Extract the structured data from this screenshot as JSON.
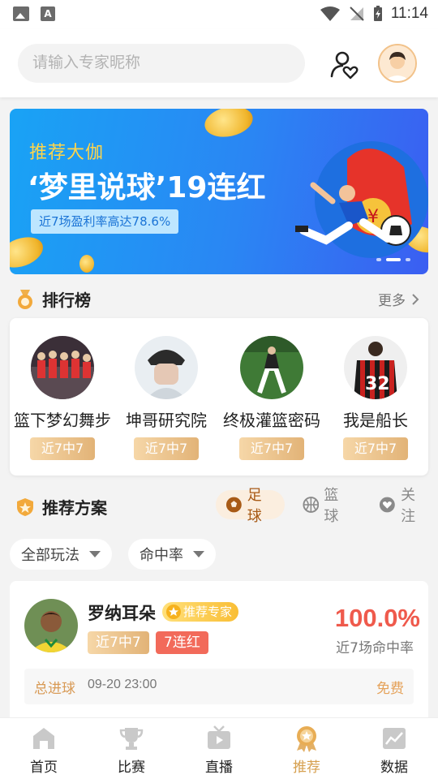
{
  "status_bar": {
    "time": "11:14",
    "left_icons": [
      "image-icon",
      "a-icon"
    ],
    "right_icons": [
      "wifi-icon",
      "no-signal-icon",
      "battery-charging-icon"
    ]
  },
  "header": {
    "search_placeholder": "请输入专家昵称",
    "icons": [
      "user-heart-icon",
      "avatar"
    ]
  },
  "banner": {
    "tag": "推荐大伽",
    "title": "‘梦里说球’19连红",
    "subtitle": "近7场盈利率高达78.6%",
    "active_slide": 1,
    "slide_count": 2
  },
  "ranking": {
    "title": "排行榜",
    "more_label": "更多",
    "items": [
      {
        "name": "篮下梦幻舞步",
        "badge": "近7中7"
      },
      {
        "name": "坤哥研究院",
        "badge": "近7中7"
      },
      {
        "name": "终极灌篮密码",
        "badge": "近7中7"
      },
      {
        "name": "我是船长",
        "badge": "近7中7"
      }
    ]
  },
  "plans": {
    "title": "推荐方案",
    "tabs": [
      {
        "label": "足球",
        "active": true
      },
      {
        "label": "篮球",
        "active": false
      },
      {
        "label": "关注",
        "active": false
      }
    ],
    "filters": [
      "全部玩法",
      "命中率"
    ],
    "card": {
      "name": "罗纳耳朵",
      "expert_tag": "推荐专家",
      "pills": [
        "近7中7",
        "7连红"
      ],
      "rate": "100.0%",
      "rate_label": "近7场命中率",
      "match": {
        "type": "总进球",
        "time": "09-20 23:00",
        "price": "免费"
      }
    }
  },
  "tabbar": {
    "items": [
      {
        "label": "首页",
        "icon": "home-icon",
        "active": false
      },
      {
        "label": "比赛",
        "icon": "trophy-icon",
        "active": false
      },
      {
        "label": "直播",
        "icon": "tv-icon",
        "active": false
      },
      {
        "label": "推荐",
        "icon": "medal-icon",
        "active": true
      },
      {
        "label": "数据",
        "icon": "chart-icon",
        "active": false
      }
    ]
  },
  "colors": {
    "accent": "#d6a04f",
    "red": "#ef5a4c",
    "banner_blue": "#2a86f3",
    "gold_badge": "#e2b377"
  }
}
